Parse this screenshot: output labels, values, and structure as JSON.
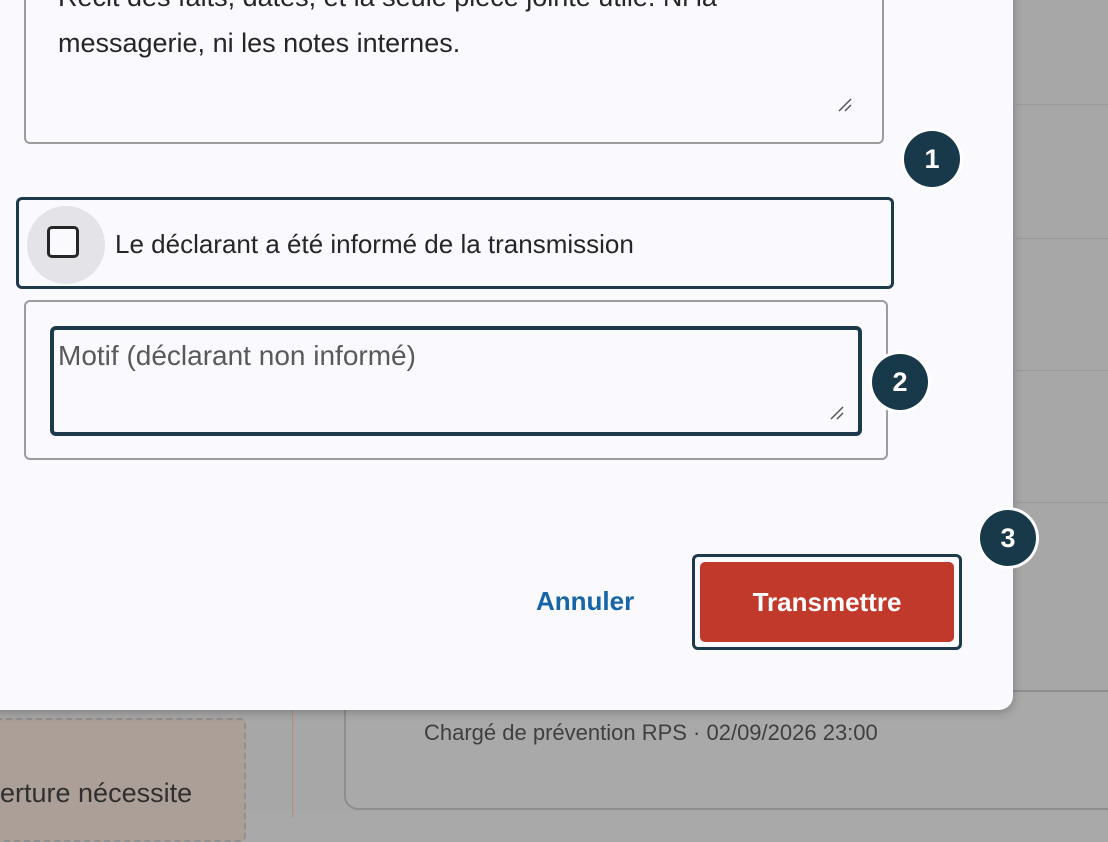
{
  "modal": {
    "description_lines": [
      "Récit des faits, dates, et la seule pièce jointe utile. Ni la",
      "messagerie, ni les notes internes."
    ],
    "checkbox_label": "Le déclarant a été informé de la transmission",
    "checkbox_checked": false,
    "motif_placeholder": "Motif (déclarant non informé)",
    "cancel_label": "Annuler",
    "submit_label": "Transmettre"
  },
  "badges": [
    "1",
    "2",
    "3"
  ],
  "background": {
    "left_card_text": "erture nécessite",
    "meta": "Chargé de prévention RPS · 02/09/2026 23:00"
  },
  "colors": {
    "primary_dark": "#1c3a49",
    "submit_red": "#c0392b",
    "link_blue": "#1565a8"
  }
}
